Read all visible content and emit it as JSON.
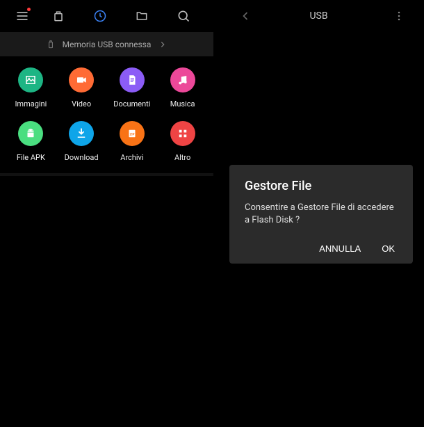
{
  "leftTopBar": {
    "menuDot": true
  },
  "banner": {
    "text": "Memoria USB connessa"
  },
  "categories": [
    {
      "id": "immagini",
      "label": "Immagini",
      "color": "#1DB584",
      "icon": "image"
    },
    {
      "id": "video",
      "label": "Video",
      "color": "#FF6B35",
      "icon": "video"
    },
    {
      "id": "documenti",
      "label": "Documenti",
      "color": "#8B5CF6",
      "icon": "document"
    },
    {
      "id": "musica",
      "label": "Musica",
      "color": "#EC4899",
      "icon": "music"
    },
    {
      "id": "apk",
      "label": "File APK",
      "color": "#4ADE80",
      "icon": "android"
    },
    {
      "id": "download",
      "label": "Download",
      "color": "#0EA5E9",
      "icon": "download"
    },
    {
      "id": "archivi",
      "label": "Archivi",
      "color": "#F97316",
      "icon": "zip"
    },
    {
      "id": "altro",
      "label": "Altro",
      "color": "#EF4444",
      "icon": "grid"
    }
  ],
  "rightPane": {
    "title": "USB"
  },
  "dialog": {
    "title": "Gestore File",
    "message": "Consentire a Gestore File di accedere a Flash Disk      ?",
    "cancel": "ANNULLA",
    "ok": "OK"
  }
}
